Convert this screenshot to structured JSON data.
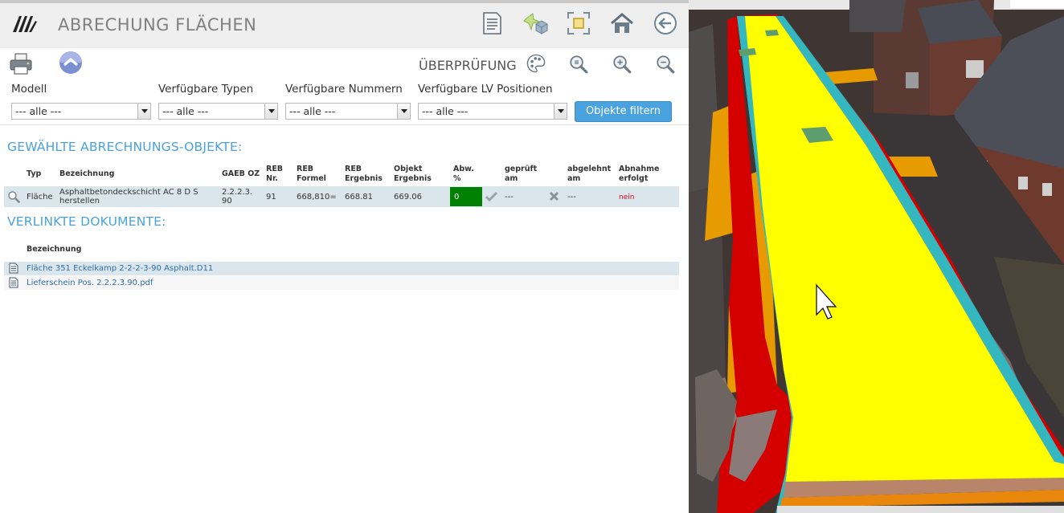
{
  "app": {
    "title": "ABRECHUNG FLÄCHEN"
  },
  "header_icons": [
    "document-icon",
    "magic-cube-icon",
    "fit-frame-icon",
    "home-icon",
    "back-arrow-icon"
  ],
  "toolbar": {
    "left_icons": [
      "printer-icon",
      "chevron-circle-icon"
    ],
    "review_label": "ÜBERPRÜFUNG",
    "right_icons": [
      "palette-icon",
      "zoom-object-icon",
      "zoom-in-icon",
      "zoom-out-icon"
    ]
  },
  "filters": {
    "modell": {
      "label": "Modell",
      "value": "--- alle ---"
    },
    "typen": {
      "label": "Verfügbare Typen",
      "value": "--- alle ---"
    },
    "nummern": {
      "label": "Verfügbare Nummern",
      "value": "--- alle ---"
    },
    "lv": {
      "label": "Verfügbare LV Positionen",
      "value": "--- alle ---"
    },
    "button": "Objekte filtern"
  },
  "objects": {
    "title": "GEWÄHLTE ABRECHNUNGS-OBJEKTE:",
    "columns": {
      "typ": "Typ",
      "bezeichnung": "Bezeichnung",
      "gaeb_1": "GAEB OZ",
      "reb_nr_1": "REB",
      "reb_nr_2": "Nr.",
      "reb_formel_1": "REB",
      "reb_formel_2": "Formel",
      "reb_erg_1": "REB",
      "reb_erg_2": "Ergebnis",
      "obj_erg_1": "Objekt",
      "obj_erg_2": "Ergebnis",
      "abw_1": "Abw.",
      "abw_2": "%",
      "geprueft_1": "geprüft",
      "geprueft_2": "am",
      "abgelehnt_1": "abgelehnt",
      "abgelehnt_2": "am",
      "abnahme_1": "Abnahme",
      "abnahme_2": "erfolgt"
    },
    "rows": [
      {
        "typ": "Fläche",
        "bezeichnung_1": "Asphaltbetondeckschicht AC 8 D S",
        "bezeichnung_2": "herstellen",
        "gaeb_1": "2.2.2.3.",
        "gaeb_2": "90",
        "reb_nr": "91",
        "reb_formel": "668,810=",
        "reb_ergebnis": "668.81",
        "objekt_ergebnis": "669.06",
        "abw": "0",
        "abw_color": "#008000",
        "geprueft_am": "---",
        "abgelehnt_am": "---",
        "abnahme": "nein"
      }
    ]
  },
  "documents": {
    "title": "VERLINKTE DOKUMENTE:",
    "column": "Bezeichnung",
    "items": [
      "Fläche 351 Eckelkamp 2-2-2-3-90 Asphalt.D11",
      "Lieferschein Pos. 2.2.2.3.90.pdf"
    ]
  },
  "colors": {
    "accent": "#4aa3de",
    "status_ok": "#008000",
    "status_no": "#d0021b",
    "road_surface": "#ffff00",
    "road_edge": "#e00000",
    "road_shoulder": "#e89b00"
  }
}
